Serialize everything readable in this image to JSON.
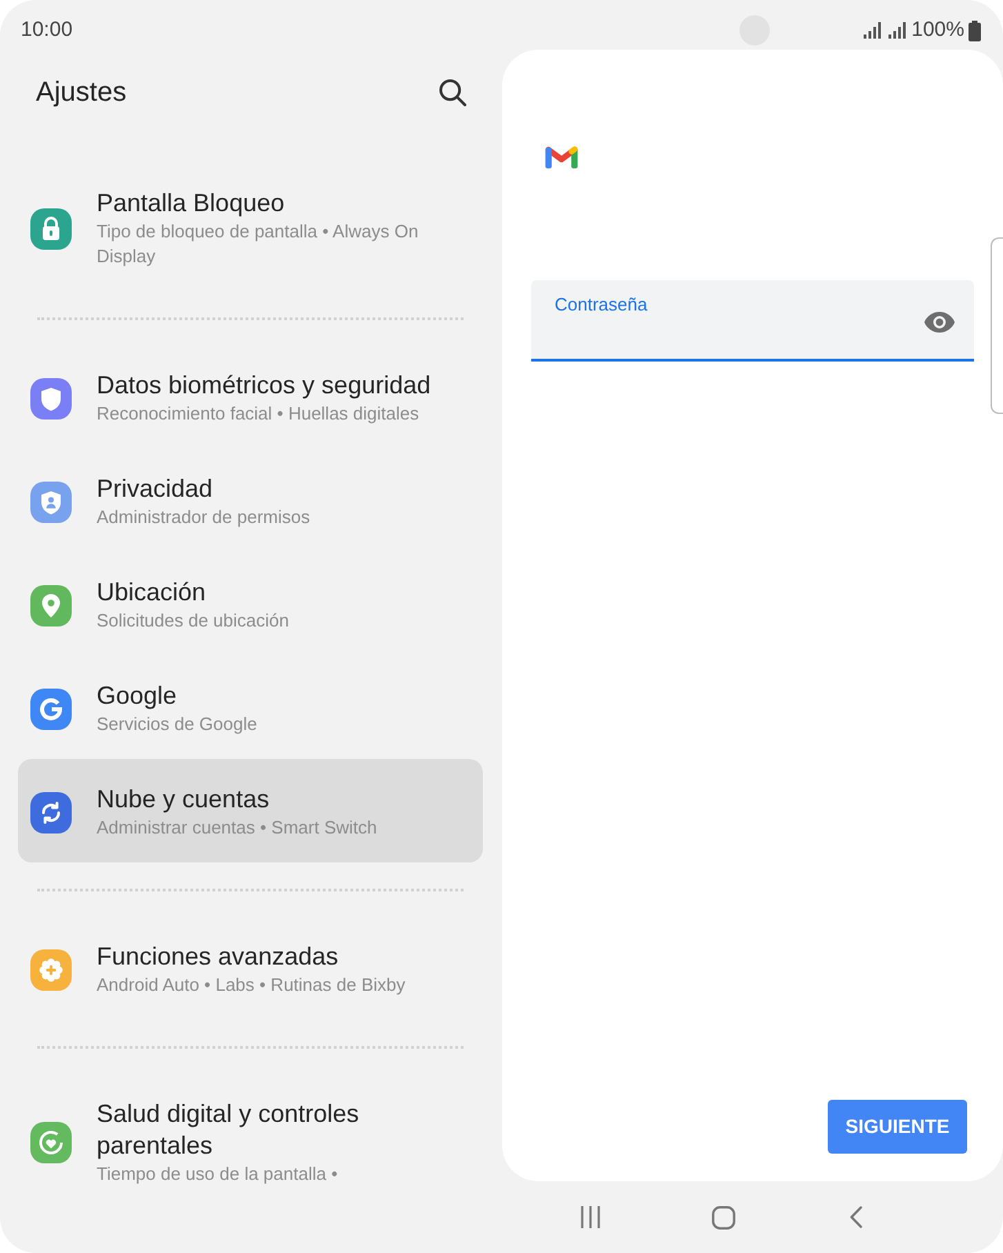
{
  "status_bar": {
    "time": "10:00",
    "battery_text": "100%"
  },
  "settings": {
    "title": "Ajustes",
    "items": [
      {
        "kind": "item",
        "title": "Pantalla Bloqueo",
        "subtitle": "Tipo de bloqueo de pantalla • Always On Display",
        "color": "#2ca58f",
        "selected": false
      },
      {
        "kind": "divider"
      },
      {
        "kind": "item",
        "title": "Datos biométricos y seguridad",
        "subtitle": "Reconocimiento facial • Huellas digitales",
        "color": "#7a7ff6",
        "selected": false
      },
      {
        "kind": "item",
        "title": "Privacidad",
        "subtitle": "Administrador de permisos",
        "color": "#78a2ee",
        "selected": false
      },
      {
        "kind": "item",
        "title": "Ubicación",
        "subtitle": "Solicitudes de ubicación",
        "color": "#62b95d",
        "selected": false
      },
      {
        "kind": "item",
        "title": "Google",
        "subtitle": "Servicios de Google",
        "color": "#3f87f5",
        "selected": false
      },
      {
        "kind": "item",
        "title": "Nube y cuentas",
        "subtitle": "Administrar cuentas • Smart Switch",
        "color": "#3e6cdf",
        "selected": true
      },
      {
        "kind": "divider"
      },
      {
        "kind": "item",
        "title": "Funciones avanzadas",
        "subtitle": "Android Auto • Labs • Rutinas de Bixby",
        "color": "#f6b23c",
        "selected": false
      },
      {
        "kind": "divider"
      },
      {
        "kind": "item",
        "title": "Salud digital y controles parentales",
        "subtitle": "Tiempo de uso de la pantalla •",
        "color": "#63ba5f",
        "selected": false
      }
    ]
  },
  "sign_in": {
    "password_field": {
      "label": "Contraseña",
      "focused": true
    },
    "next_button": "SIGUIENTE"
  }
}
